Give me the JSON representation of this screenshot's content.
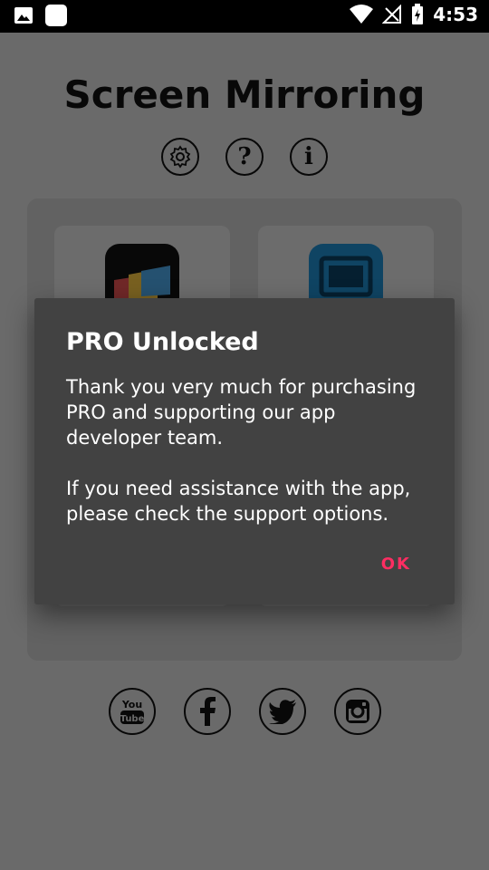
{
  "status_bar": {
    "time": "4:53"
  },
  "app": {
    "title": "Screen Mirroring"
  },
  "header_icons": [
    "gear-icon",
    "help-icon",
    "info-icon"
  ],
  "social_icons": [
    "youtube-icon",
    "facebook-icon",
    "twitter-icon",
    "instagram-icon"
  ],
  "dialog": {
    "title": "PRO Unlocked",
    "paragraph1": "Thank you very much for purchasing PRO and supporting our app developer team.",
    "paragraph2": "If you need assistance with the app, please check the support options.",
    "ok_label": "OK"
  },
  "colors": {
    "accent": "#ff2d62",
    "dialog_bg": "#424242",
    "cast_blue": "#1e88c7"
  }
}
